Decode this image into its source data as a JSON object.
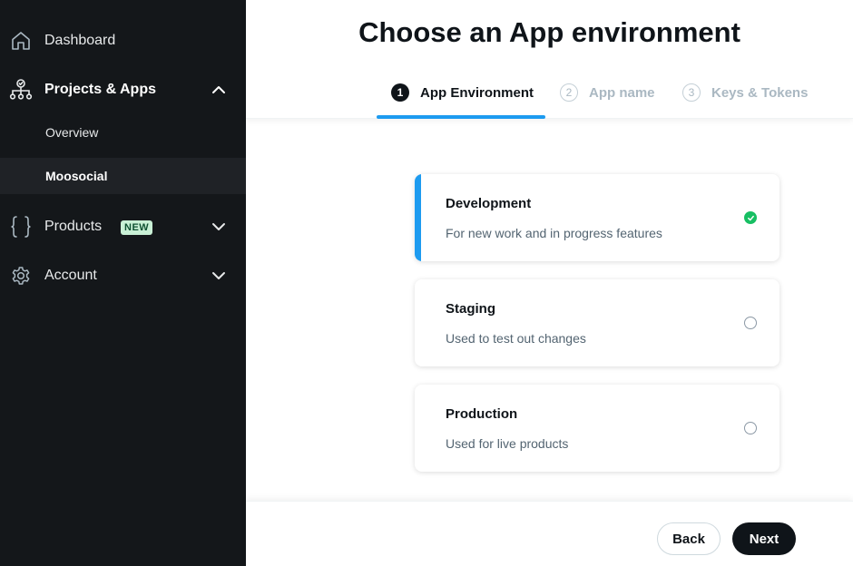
{
  "sidebar": {
    "dashboard": {
      "label": "Dashboard",
      "icon": "home-icon"
    },
    "projects": {
      "label": "Projects & Apps",
      "icon": "projects-icon",
      "expanded": true
    },
    "sub_items": [
      {
        "label": "Overview",
        "active": false
      },
      {
        "label": "Moosocial",
        "active": true
      }
    ],
    "products": {
      "label": "Products",
      "badge": "NEW",
      "icon": "braces-icon"
    },
    "account": {
      "label": "Account",
      "icon": "gear-icon"
    }
  },
  "main": {
    "title": "Choose an App environment",
    "steps": [
      {
        "number": "1",
        "label": "App Environment",
        "active": true
      },
      {
        "number": "2",
        "label": "App name",
        "active": false
      },
      {
        "number": "3",
        "label": "Keys & Tokens",
        "active": false
      }
    ],
    "options": [
      {
        "title": "Development",
        "description": "For new work and in progress features",
        "selected": true
      },
      {
        "title": "Staging",
        "description": "Used to test out changes",
        "selected": false
      },
      {
        "title": "Production",
        "description": "Used for live products",
        "selected": false
      }
    ],
    "buttons": {
      "back": "Back",
      "next": "Next"
    }
  },
  "colors": {
    "sidebar_bg": "#14171a",
    "accent": "#1d9bf0",
    "selected_check": "#17bf63",
    "badge_bg": "#c9f0d6"
  }
}
